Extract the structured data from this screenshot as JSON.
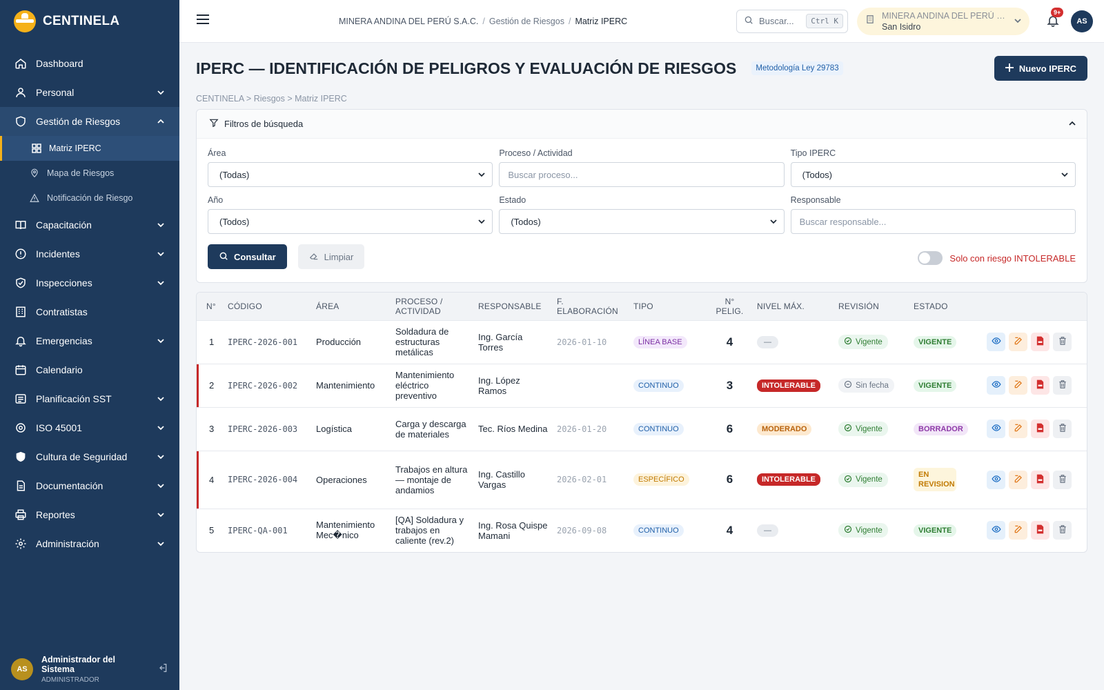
{
  "brand": {
    "name": "CENTINELA",
    "brand_color": "#1e3a5c",
    "accent": "#f5b119"
  },
  "sidebar": {
    "items": [
      {
        "label": "Dashboard",
        "icon": "home-icon"
      },
      {
        "label": "Personal",
        "icon": "user-icon"
      },
      {
        "label": "Gestión de Riesgos",
        "icon": "shield-icon"
      },
      {
        "label": "Capacitación",
        "icon": "book-icon"
      },
      {
        "label": "Incidentes",
        "icon": "alert-circle-icon"
      },
      {
        "label": "Inspecciones",
        "icon": "shield-check-icon"
      },
      {
        "label": "Contratistas",
        "icon": "building-icon"
      },
      {
        "label": "Emergencias",
        "icon": "bell-icon"
      },
      {
        "label": "Calendario",
        "icon": "calendar-icon"
      },
      {
        "label": "Planificación SST",
        "icon": "list-icon"
      },
      {
        "label": "ISO 45001",
        "icon": "gear-circle-icon"
      },
      {
        "label": "Cultura de Seguridad",
        "icon": "shield-heart-icon"
      },
      {
        "label": "Documentación",
        "icon": "document-icon"
      },
      {
        "label": "Reportes",
        "icon": "printer-icon"
      },
      {
        "label": "Administración",
        "icon": "gear-icon"
      }
    ],
    "subitems": [
      {
        "label": "Matriz IPERC",
        "icon": "grid-icon"
      },
      {
        "label": "Mapa de Riesgos",
        "icon": "map-pin-icon"
      },
      {
        "label": "Notificación de Riesgo",
        "icon": "warning-icon"
      }
    ],
    "user": {
      "initials": "AS",
      "name": "Administrador del Sistema",
      "role": "ADMINISTRADOR"
    }
  },
  "topbar": {
    "breadcrumb": [
      "MINERA ANDINA DEL PERÚ S.A.C.",
      "Gestión de Riesgos",
      "Matriz IPERC"
    ],
    "search_placeholder": "Buscar...",
    "search_shortcut": "Ctrl K",
    "org_name": "MINERA ANDINA DEL PERÚ S.A.C.",
    "org_location": "San Isidro",
    "notifications": "9+",
    "avatar": "AS"
  },
  "page": {
    "title": "IPERC — IDENTIFICACIÓN DE PELIGROS Y EVALUACIÓN DE RIESGOS",
    "methodology": "Metodología Ley 29783",
    "new_button": "Nuevo IPERC",
    "sub_breadcrumb": "CENTINELA > Riesgos > Matriz IPERC"
  },
  "filters": {
    "title": "Filtros de búsqueda",
    "area_label": "Área",
    "area_value": "(Todas)",
    "process_label": "Proceso / Actividad",
    "process_placeholder": "Buscar proceso...",
    "type_label": "Tipo IPERC",
    "type_value": "(Todos)",
    "year_label": "Año",
    "year_value": "(Todos)",
    "status_label": "Estado",
    "status_value": "(Todos)",
    "owner_label": "Responsable",
    "owner_placeholder": "Buscar responsable...",
    "query_button": "Consultar",
    "clear_button": "Limpiar",
    "toggle_label": "Solo con riesgo INTOLERABLE",
    "toggle_on": false
  },
  "table": {
    "headers": [
      "N°",
      "CÓDIGO",
      "ÁREA",
      "PROCESO / ACTIVIDAD",
      "RESPONSABLE",
      "F. ELABORACIÓN",
      "TIPO",
      "N° PELIG.",
      "NIVEL MÁX.",
      "REVISIÓN",
      "ESTADO"
    ],
    "rows": [
      {
        "n": "1",
        "code": "IPERC-2026-001",
        "area": "Producción",
        "process": "Soldadura de estructuras metálicas",
        "owner": "Ing. García Torres",
        "date": "2026-01-10",
        "type": "LÍNEA BASE",
        "hazards": "4",
        "level": "—",
        "revision": "Vigente",
        "status": "VIGENTE"
      },
      {
        "n": "2",
        "code": "IPERC-2026-002",
        "area": "Mantenimiento",
        "process": "Mantenimiento eléctrico preventivo",
        "owner": "Ing. López Ramos",
        "date": "",
        "type": "CONTINUO",
        "hazards": "3",
        "level": "INTOLERABLE",
        "revision": "Sin fecha",
        "status": "VIGENTE"
      },
      {
        "n": "3",
        "code": "IPERC-2026-003",
        "area": "Logística",
        "process": "Carga y descarga de materiales",
        "owner": "Tec. Ríos Medina",
        "date": "2026-01-20",
        "type": "CONTINUO",
        "hazards": "6",
        "level": "MODERADO",
        "revision": "Vigente",
        "status": "BORRADOR"
      },
      {
        "n": "4",
        "code": "IPERC-2026-004",
        "area": "Operaciones",
        "process": "Trabajos en altura — montaje de andamios",
        "owner": "Ing. Castillo Vargas",
        "date": "2026-02-01",
        "type": "ESPECÍFICO",
        "hazards": "6",
        "level": "INTOLERABLE",
        "revision": "Vigente",
        "status": "EN REVISION"
      },
      {
        "n": "5",
        "code": "IPERC-QA-001",
        "area": "Mantenimiento Mec�nico",
        "process": "[QA] Soldadura y trabajos en caliente (rev.2)",
        "owner": "Ing. Rosa Quispe Mamani",
        "date": "2026-09-08",
        "type": "CONTINUO",
        "hazards": "4",
        "level": "—",
        "revision": "Vigente",
        "status": "VIGENTE"
      }
    ]
  }
}
